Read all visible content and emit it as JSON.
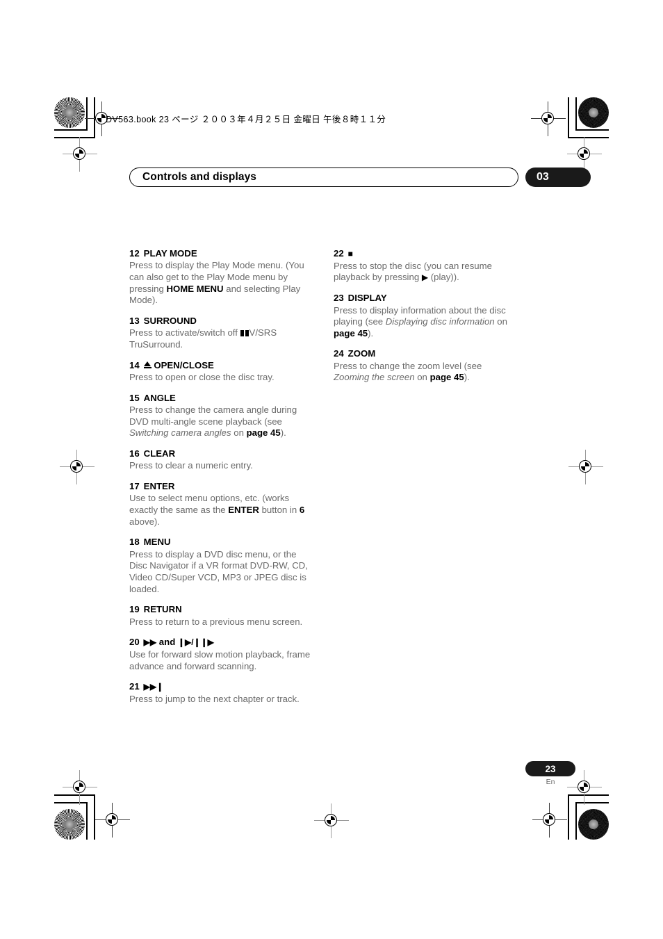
{
  "print_marks": {
    "book_line": "DV563.book  23 ページ  ２００３年４月２５日  金曜日  午後８時１１分"
  },
  "header": {
    "running_title": "Controls and displays",
    "chapter_number": "03"
  },
  "footer": {
    "page_number": "23",
    "language_code": "En"
  },
  "columns": {
    "left": [
      {
        "number": "12",
        "title": "PLAY MODE",
        "body_html": "Press to display the Play Mode menu. (You can also get to the Play Mode menu by pressing <b>HOME MENU</b> and selecting Play Mode)."
      },
      {
        "number": "13",
        "title": "SURROUND",
        "body_html": "Press to activate/switch off <span class=\"dolby\"></span>V/SRS TruSurround."
      },
      {
        "number": "14",
        "title_html": "<span class=\"eject\"></span> OPEN/CLOSE",
        "title": "OPEN/CLOSE",
        "body_html": "Press to open or close the disc tray."
      },
      {
        "number": "15",
        "title": "ANGLE",
        "body_html": "Press to change the camera angle during DVD multi-angle scene playback (see <i>Switching camera angles</i> on <b>page 45</b>)."
      },
      {
        "number": "16",
        "title": "CLEAR",
        "body_html": "Press to clear a numeric entry."
      },
      {
        "number": "17",
        "title": "ENTER",
        "body_html": "Use to select menu options, etc. (works exactly the same as the <b>ENTER</b> button in <b>6</b> above)."
      },
      {
        "number": "18",
        "title": "MENU",
        "body_html": "Press to display a DVD disc menu, or the Disc Navigator if a VR format DVD-RW, CD, Video CD/Super VCD, MP3 or JPEG disc is loaded."
      },
      {
        "number": "19",
        "title": "RETURN",
        "body_html": "Press to return to a previous menu screen."
      },
      {
        "number": "20",
        "title_html": "<span class=\"glyph\">▶▶</span> and <span class=\"glyph\">❙▶/❙❙▶</span>",
        "title": "fast-forward and frame-advance",
        "body_html": "Use for forward slow motion playback, frame advance and forward scanning."
      },
      {
        "number": "21",
        "title_html": "<span class=\"glyph\">▶▶❙</span>",
        "title": "next-chapter-skip",
        "body_html": "Press to jump to the next chapter or track."
      }
    ],
    "right": [
      {
        "number": "22",
        "title_html": "<span class=\"glyph\">■</span>",
        "title": "stop",
        "body_html": "Press to stop the disc (you can resume playback by pressing <span class=\"glyph\">▶</span> (play))."
      },
      {
        "number": "23",
        "title": "DISPLAY",
        "body_html": "Press to display information about the disc playing (see <i>Displaying disc information</i> on <b>page 45</b>)."
      },
      {
        "number": "24",
        "title": "ZOOM",
        "body_html": "Press to change the zoom level (see <i>Zooming the screen</i> on <b>page 45</b>)."
      }
    ]
  }
}
